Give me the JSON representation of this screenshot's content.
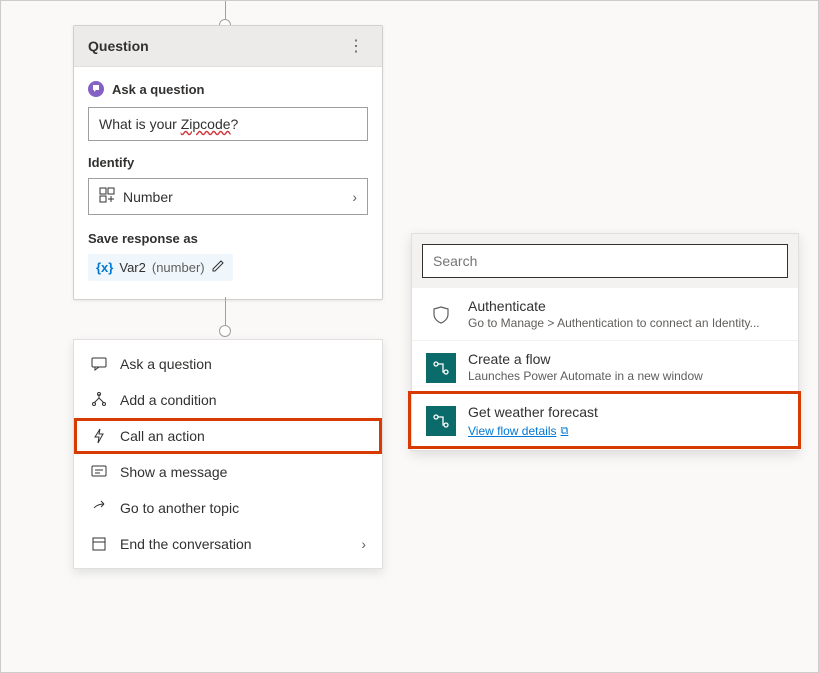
{
  "question_card": {
    "header_title": "Question",
    "ask_label": "Ask a question",
    "question_text_prefix": "What is your ",
    "question_text_zip": "Zipcode",
    "question_text_suffix": "?",
    "identify_label": "Identify",
    "identify_value": "Number",
    "save_label": "Save response as",
    "var_name": "Var2",
    "var_type": "(number)"
  },
  "action_menu": {
    "items": [
      {
        "label": "Ask a question",
        "icon": "chat"
      },
      {
        "label": "Add a condition",
        "icon": "branch"
      },
      {
        "label": "Call an action",
        "icon": "bolt",
        "highlight": true
      },
      {
        "label": "Show a message",
        "icon": "message"
      },
      {
        "label": "Go to another topic",
        "icon": "share"
      },
      {
        "label": "End the conversation",
        "icon": "panel",
        "chevron": true
      }
    ]
  },
  "flyout": {
    "search_placeholder": "Search",
    "items": [
      {
        "title": "Authenticate",
        "sub": "Go to Manage > Authentication to connect an Identity...",
        "icon": "shield"
      },
      {
        "title": "Create a flow",
        "sub": "Launches Power Automate in a new window",
        "icon": "flow"
      },
      {
        "title": "Get weather forecast",
        "link": "View flow details",
        "icon": "flow",
        "highlight": true
      }
    ]
  }
}
